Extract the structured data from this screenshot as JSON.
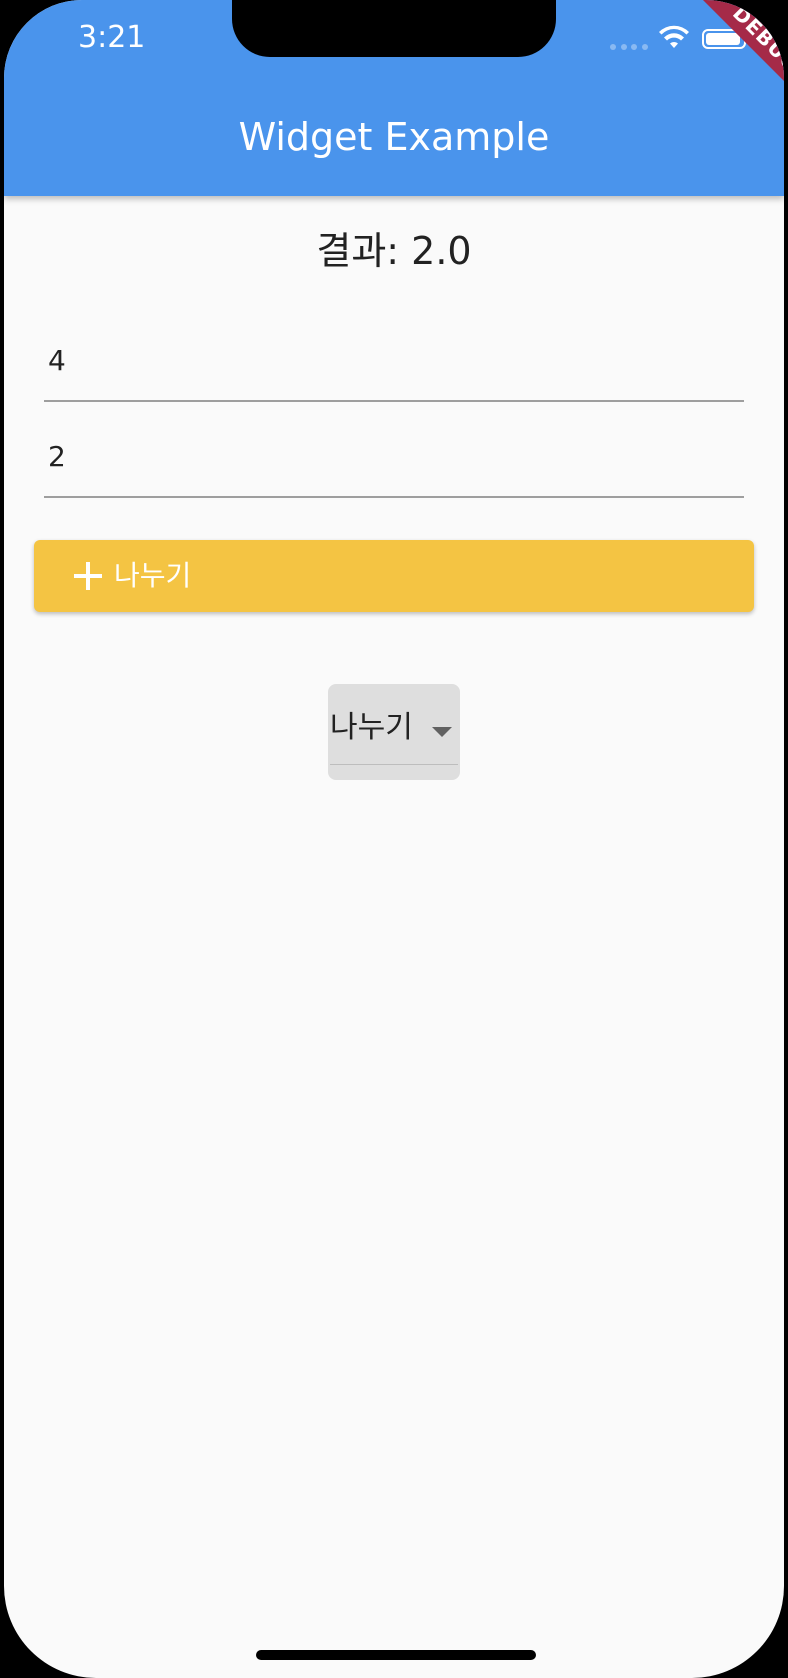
{
  "status_bar": {
    "time": "3:21",
    "icons": [
      "signal-dots-icon",
      "wifi-icon",
      "battery-icon"
    ]
  },
  "debug_banner": "DEBUG",
  "app_bar": {
    "title": "Widget Example",
    "color": "#4a94ec"
  },
  "result": {
    "text": "결과: 2.0"
  },
  "inputs": {
    "first_value": "4",
    "second_value": "2"
  },
  "action_button": {
    "icon": "plus-icon",
    "label": "나누기",
    "color": "#f4c443"
  },
  "operation_dropdown": {
    "selected": "나누기",
    "icon": "arrow-drop-down-icon"
  }
}
